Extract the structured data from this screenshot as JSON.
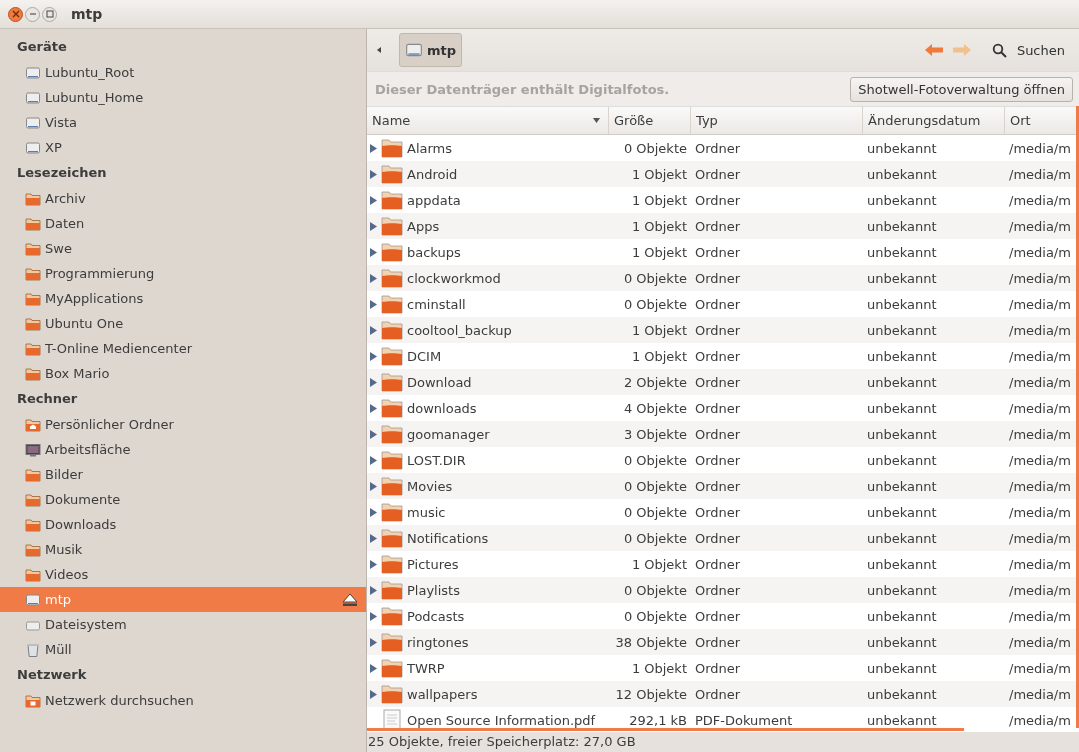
{
  "window": {
    "title": "mtp"
  },
  "sidebar": [
    {
      "heading": "Geräte",
      "items": [
        {
          "label": "Lubuntu_Root",
          "kind": "drive",
          "selected": false,
          "eject": false
        },
        {
          "label": "Lubuntu_Home",
          "kind": "drive",
          "selected": false,
          "eject": false
        },
        {
          "label": "Vista",
          "kind": "drive",
          "selected": false,
          "eject": false
        },
        {
          "label": "XP",
          "kind": "drive",
          "selected": false,
          "eject": false
        }
      ]
    },
    {
      "heading": "Lesezeichen",
      "items": [
        {
          "label": "Archiv",
          "kind": "folder",
          "selected": false,
          "eject": false
        },
        {
          "label": "Daten",
          "kind": "folder",
          "selected": false,
          "eject": false
        },
        {
          "label": "Swe",
          "kind": "folder",
          "selected": false,
          "eject": false
        },
        {
          "label": "Programmierung",
          "kind": "folder",
          "selected": false,
          "eject": false
        },
        {
          "label": "MyApplications",
          "kind": "folder",
          "selected": false,
          "eject": false
        },
        {
          "label": "Ubuntu One",
          "kind": "folder",
          "selected": false,
          "eject": false
        },
        {
          "label": "T-Online Mediencenter",
          "kind": "folder",
          "selected": false,
          "eject": false
        },
        {
          "label": "Box Mario",
          "kind": "folder",
          "selected": false,
          "eject": false
        }
      ]
    },
    {
      "heading": "Rechner",
      "items": [
        {
          "label": "Persönlicher Ordner",
          "kind": "home",
          "selected": false,
          "eject": false
        },
        {
          "label": "Arbeitsfläche",
          "kind": "desktop",
          "selected": false,
          "eject": false
        },
        {
          "label": "Bilder",
          "kind": "folder",
          "selected": false,
          "eject": false
        },
        {
          "label": "Dokumente",
          "kind": "folder",
          "selected": false,
          "eject": false
        },
        {
          "label": "Downloads",
          "kind": "folder",
          "selected": false,
          "eject": false
        },
        {
          "label": "Musik",
          "kind": "folder",
          "selected": false,
          "eject": false
        },
        {
          "label": "Videos",
          "kind": "folder",
          "selected": false,
          "eject": false
        },
        {
          "label": "mtp",
          "kind": "drive",
          "selected": true,
          "eject": true
        },
        {
          "label": "Dateisystem",
          "kind": "filesystem",
          "selected": false,
          "eject": false
        },
        {
          "label": "Müll",
          "kind": "trash",
          "selected": false,
          "eject": false
        }
      ]
    },
    {
      "heading": "Netzwerk",
      "items": [
        {
          "label": "Netzwerk durchsuchen",
          "kind": "network",
          "selected": false,
          "eject": false
        }
      ]
    }
  ],
  "toolbar": {
    "path_button": "mtp",
    "search_label": "Suchen"
  },
  "info_bar": {
    "message": "Dieser Datenträger enthält Digitalfotos.",
    "button": "Shotwell-Fotoverwaltung öffnen"
  },
  "table": {
    "columns": [
      "Name",
      "Größe",
      "Typ",
      "Änderungsdatum",
      "Ort"
    ],
    "rows": [
      {
        "kind": "folder",
        "name": "Alarms",
        "size": "0 Objekte",
        "type": "Ordner",
        "date": "unbekannt",
        "location": "/media/m"
      },
      {
        "kind": "folder",
        "name": "Android",
        "size": "1 Objekt",
        "type": "Ordner",
        "date": "unbekannt",
        "location": "/media/m"
      },
      {
        "kind": "folder",
        "name": "appdata",
        "size": "1 Objekt",
        "type": "Ordner",
        "date": "unbekannt",
        "location": "/media/m"
      },
      {
        "kind": "folder",
        "name": "Apps",
        "size": "1 Objekt",
        "type": "Ordner",
        "date": "unbekannt",
        "location": "/media/m"
      },
      {
        "kind": "folder",
        "name": "backups",
        "size": "1 Objekt",
        "type": "Ordner",
        "date": "unbekannt",
        "location": "/media/m"
      },
      {
        "kind": "folder",
        "name": "clockworkmod",
        "size": "0 Objekte",
        "type": "Ordner",
        "date": "unbekannt",
        "location": "/media/m"
      },
      {
        "kind": "folder",
        "name": "cminstall",
        "size": "0 Objekte",
        "type": "Ordner",
        "date": "unbekannt",
        "location": "/media/m"
      },
      {
        "kind": "folder",
        "name": "cooltool_backup",
        "size": "1 Objekt",
        "type": "Ordner",
        "date": "unbekannt",
        "location": "/media/m"
      },
      {
        "kind": "folder",
        "name": "DCIM",
        "size": "1 Objekt",
        "type": "Ordner",
        "date": "unbekannt",
        "location": "/media/m"
      },
      {
        "kind": "folder",
        "name": "Download",
        "size": "2 Objekte",
        "type": "Ordner",
        "date": "unbekannt",
        "location": "/media/m"
      },
      {
        "kind": "folder",
        "name": "downloads",
        "size": "4 Objekte",
        "type": "Ordner",
        "date": "unbekannt",
        "location": "/media/m"
      },
      {
        "kind": "folder",
        "name": "goomanager",
        "size": "3 Objekte",
        "type": "Ordner",
        "date": "unbekannt",
        "location": "/media/m"
      },
      {
        "kind": "folder",
        "name": "LOST.DIR",
        "size": "0 Objekte",
        "type": "Ordner",
        "date": "unbekannt",
        "location": "/media/m"
      },
      {
        "kind": "folder",
        "name": "Movies",
        "size": "0 Objekte",
        "type": "Ordner",
        "date": "unbekannt",
        "location": "/media/m"
      },
      {
        "kind": "folder",
        "name": "music",
        "size": "0 Objekte",
        "type": "Ordner",
        "date": "unbekannt",
        "location": "/media/m"
      },
      {
        "kind": "folder",
        "name": "Notifications",
        "size": "0 Objekte",
        "type": "Ordner",
        "date": "unbekannt",
        "location": "/media/m"
      },
      {
        "kind": "folder",
        "name": "Pictures",
        "size": "1 Objekt",
        "type": "Ordner",
        "date": "unbekannt",
        "location": "/media/m"
      },
      {
        "kind": "folder",
        "name": "Playlists",
        "size": "0 Objekte",
        "type": "Ordner",
        "date": "unbekannt",
        "location": "/media/m"
      },
      {
        "kind": "folder",
        "name": "Podcasts",
        "size": "0 Objekte",
        "type": "Ordner",
        "date": "unbekannt",
        "location": "/media/m"
      },
      {
        "kind": "folder",
        "name": "ringtones",
        "size": "38 Objekte",
        "type": "Ordner",
        "date": "unbekannt",
        "location": "/media/m"
      },
      {
        "kind": "folder",
        "name": "TWRP",
        "size": "1 Objekt",
        "type": "Ordner",
        "date": "unbekannt",
        "location": "/media/m"
      },
      {
        "kind": "folder",
        "name": "wallpapers",
        "size": "12 Objekte",
        "type": "Ordner",
        "date": "unbekannt",
        "location": "/media/m"
      },
      {
        "kind": "file",
        "name": "Open Source Information.pdf",
        "size": "292,1 kB",
        "type": "PDF-Dokument",
        "date": "unbekannt",
        "location": "/media/m"
      }
    ]
  },
  "status_bar": "25 Objekte, freier Speicherplatz: 27,0 GB"
}
